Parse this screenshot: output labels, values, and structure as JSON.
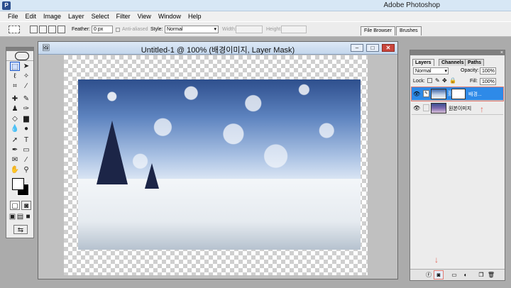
{
  "app": {
    "title": "Adobe Photoshop"
  },
  "menu": [
    "File",
    "Edit",
    "Image",
    "Layer",
    "Select",
    "Filter",
    "View",
    "Window",
    "Help"
  ],
  "options": {
    "feather_label": "Feather:",
    "feather_value": "0 px",
    "antialiased_label": "Anti-aliased",
    "style_label": "Style:",
    "style_value": "Normal",
    "width_label": "Width:",
    "height_label": "Height:"
  },
  "palette_well": {
    "tabs": [
      "File Browser",
      "Brushes"
    ]
  },
  "document": {
    "title": "Untitled-1 @ 100% (배경이미지, Layer Mask)"
  },
  "layers_panel": {
    "tabs": [
      "Layers",
      "Channels",
      "Paths"
    ],
    "blend_mode": "Normal",
    "opacity_label": "Opacity:",
    "opacity_value": "100%",
    "lock_label": "Lock:",
    "fill_label": "Fill:",
    "fill_value": "100%",
    "layers": [
      {
        "name": "배경...",
        "selected": true,
        "has_mask": true
      },
      {
        "name": "원본이미지",
        "selected": false,
        "has_mask": false
      }
    ]
  },
  "colors": {
    "accent": "#2e8ae8",
    "annotation": "#e3675c"
  }
}
